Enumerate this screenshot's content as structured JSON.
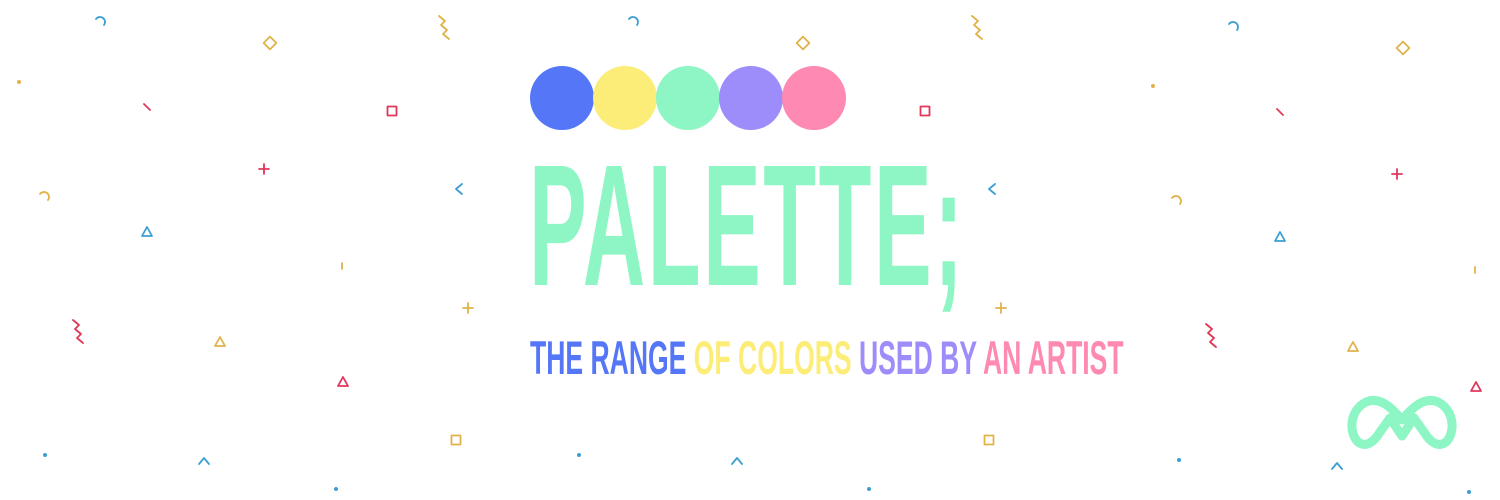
{
  "banner": {
    "title": "PALETTE;",
    "tagline": [
      {
        "text": "THE RANGE ",
        "color": "#5577f7"
      },
      {
        "text": "OF COLORS ",
        "color": "#fced78"
      },
      {
        "text": "USED BY ",
        "color": "#9d8dfb"
      },
      {
        "text": "AN ARTIST",
        "color": "#fe89b3"
      }
    ],
    "palette": [
      "#5577f7",
      "#fced78",
      "#8df6c4",
      "#9d8dfb",
      "#fe89b3"
    ],
    "title_color": "#8df6c4",
    "confetti_colors": {
      "red": "#e0375a",
      "gold": "#e0b24a",
      "blue": "#3d9fd1"
    },
    "logo": {
      "icon": "mm-logo-icon",
      "color": "#8df6c4"
    }
  }
}
